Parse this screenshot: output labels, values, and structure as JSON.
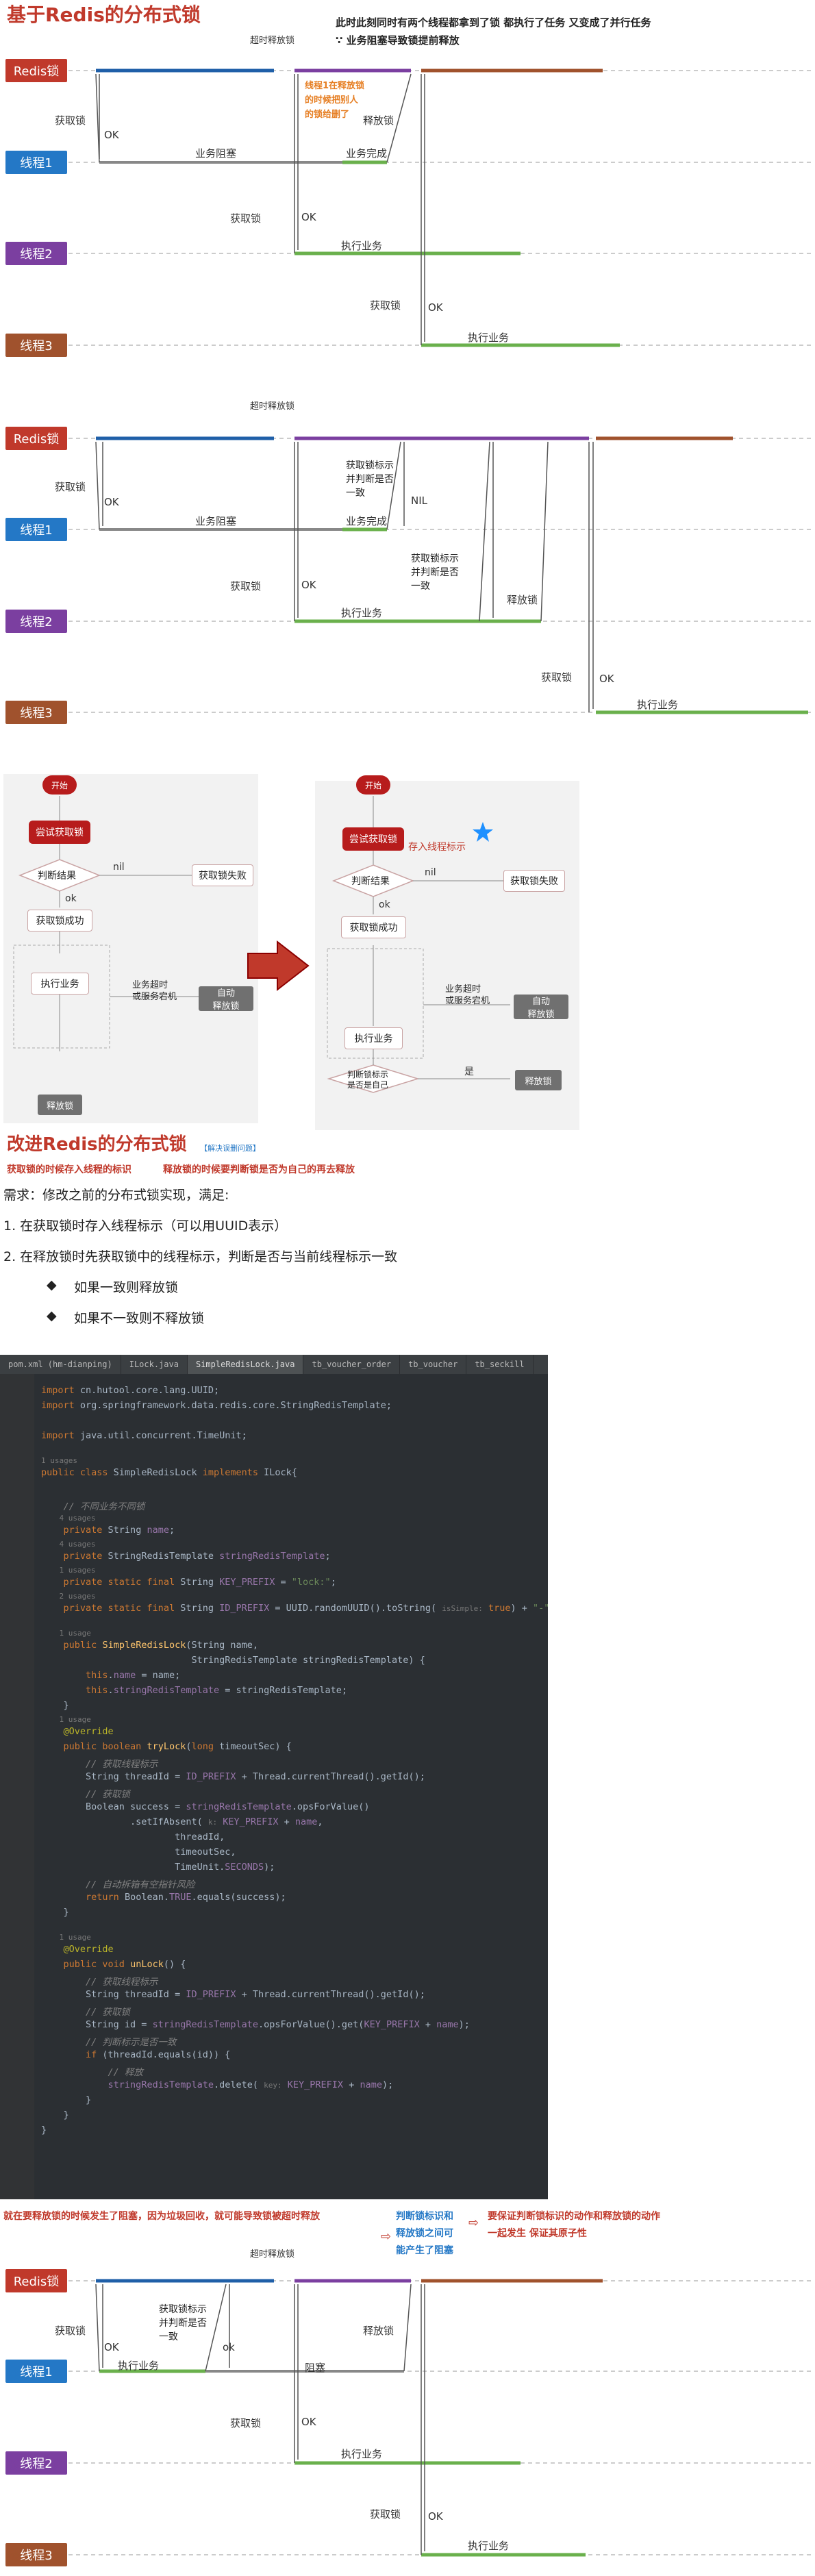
{
  "section1": {
    "title": "基于Redis的分布式锁",
    "top_note_1": "此时此刻同时有两个线程都拿到了锁 都执行了任务 又变成了并行任务",
    "top_note_2": "∵ 业务阻塞导致锁提前释放",
    "timeout_label": "超时释放锁",
    "orange_note": "线程1在释放锁\n的时候把别人\n的锁给删了",
    "lanes": [
      "Redis锁",
      "线程1",
      "线程2",
      "线程3"
    ],
    "get_lock": "获取锁",
    "ok": "OK",
    "blocked": "业务阻塞",
    "biz_done": "业务完成",
    "release": "释放锁",
    "exec": "执行业务"
  },
  "section2": {
    "timeout_label": "超时释放锁",
    "lanes": [
      "Redis锁",
      "线程1",
      "线程2",
      "线程3"
    ],
    "get_lock": "获取锁",
    "ok": "OK",
    "nil": "NIL",
    "blocked": "业务阻塞",
    "biz_done": "业务完成",
    "check_note": "获取锁标示\n并判断是否\n一致",
    "release": "释放锁",
    "exec": "执行业务"
  },
  "flow_left": {
    "start": "开始",
    "try_lock": "尝试获取锁",
    "judge": "判断结果",
    "nil": "nil",
    "fail": "获取锁失败",
    "ok": "ok",
    "success": "获取锁成功",
    "timeout": "业务超时\n或服务宕机",
    "auto_release": "自动\n释放锁",
    "exec": "执行业务",
    "release": "释放锁"
  },
  "flow_right": {
    "start": "开始",
    "try_lock": "尝试获取锁",
    "store_id": "存入线程标示",
    "judge": "判断结果",
    "nil": "nil",
    "fail": "获取锁失败",
    "ok": "ok",
    "success": "获取锁成功",
    "timeout": "业务超时\n或服务宕机",
    "auto_release": "自动\n释放锁",
    "exec": "执行业务",
    "check": "判断锁标示\n是否是自己",
    "yes": "是",
    "release": "释放锁"
  },
  "section3": {
    "title": "改进Redis的分布式锁",
    "title_tag": "【解决误删问题】",
    "sub_note_a": "获取锁的时候存入线程的标识",
    "sub_note_b": "释放锁的时候要判断锁是否为自己的再去释放",
    "requirement": "需求：修改之前的分布式锁实现，满足:",
    "items": [
      "1.  在获取锁时存入线程标示（可以用UUID表示）",
      "2.  在释放锁时先获取锁中的线程标示，判断是否与当前线程标示一致"
    ],
    "bullets": [
      "如果一致则释放锁",
      "如果不一致则不释放锁"
    ]
  },
  "code": {
    "tabs": [
      "pom.xml (hm-dianping)",
      "ILock.java",
      "SimpleRedisLock.java",
      "tb_voucher_order",
      "tb_voucher",
      "tb_seckill"
    ]
  },
  "section4": {
    "note_red": "就在要释放锁的时候发生了阻塞，因为垃圾回收，就可能导致锁被超时释放",
    "note_blue_1": "判断锁标识和",
    "note_blue_2": "释放锁之间可",
    "note_blue_3": "能产生了阻塞",
    "note_red_2": "要保证判断锁标识的动作和释放锁的动作",
    "note_red_3": "一起发生  保证其原子性",
    "timeout_label": "超时释放锁",
    "lanes": [
      "Redis锁",
      "线程1",
      "线程2",
      "线程3"
    ],
    "get_lock": "获取锁",
    "ok": "OK",
    "ok_lower": "ok",
    "check_note": "获取锁标示\n并判断是否\n一致",
    "release": "释放锁",
    "blocked": "阻塞",
    "exec": "执行业务"
  }
}
